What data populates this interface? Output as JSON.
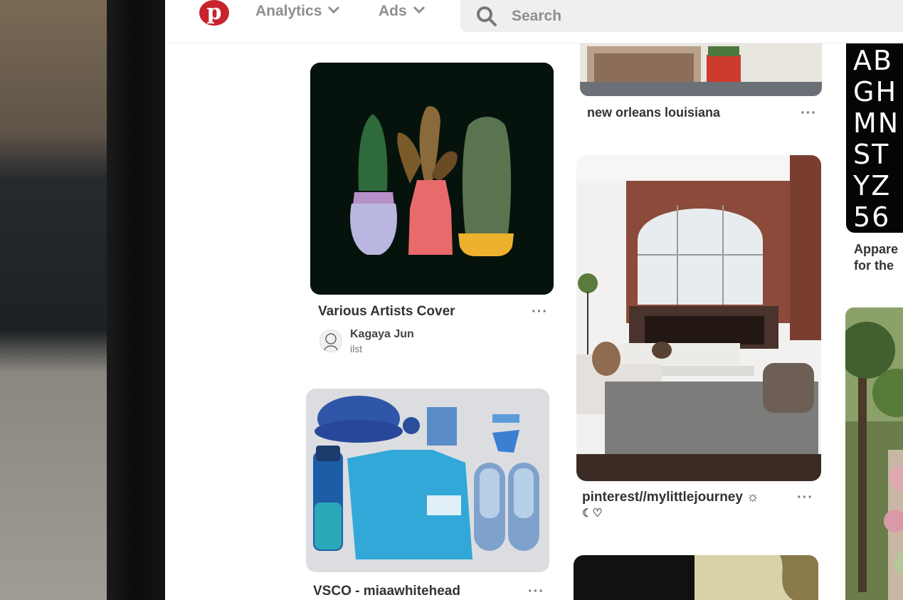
{
  "nav": {
    "analytics_label": "Analytics",
    "ads_label": "Ads",
    "logo_letter": "p"
  },
  "search": {
    "placeholder": "Search"
  },
  "pins": {
    "new_orleans": {
      "title": "new orleans louisiana",
      "more": "···"
    },
    "various_artists": {
      "title": "Various Artists Cover",
      "more": "···",
      "author_name": "Kagaya Jun",
      "author_sub": "ilst"
    },
    "interior": {
      "title": "pinterest//mylittlejourney ☼",
      "subtitle": "☾♡",
      "more": "···"
    },
    "vsco": {
      "title": "VSCO - miaawhitehead",
      "more": "···"
    },
    "apparel": {
      "title_line1": "Appare",
      "title_line2": "for the"
    },
    "typography_letters": [
      "AB",
      "GH",
      "MN",
      "ST",
      "YZ",
      "56"
    ]
  },
  "colors": {
    "brand_red": "#c8232c",
    "cactus_bg": "#06130c"
  }
}
